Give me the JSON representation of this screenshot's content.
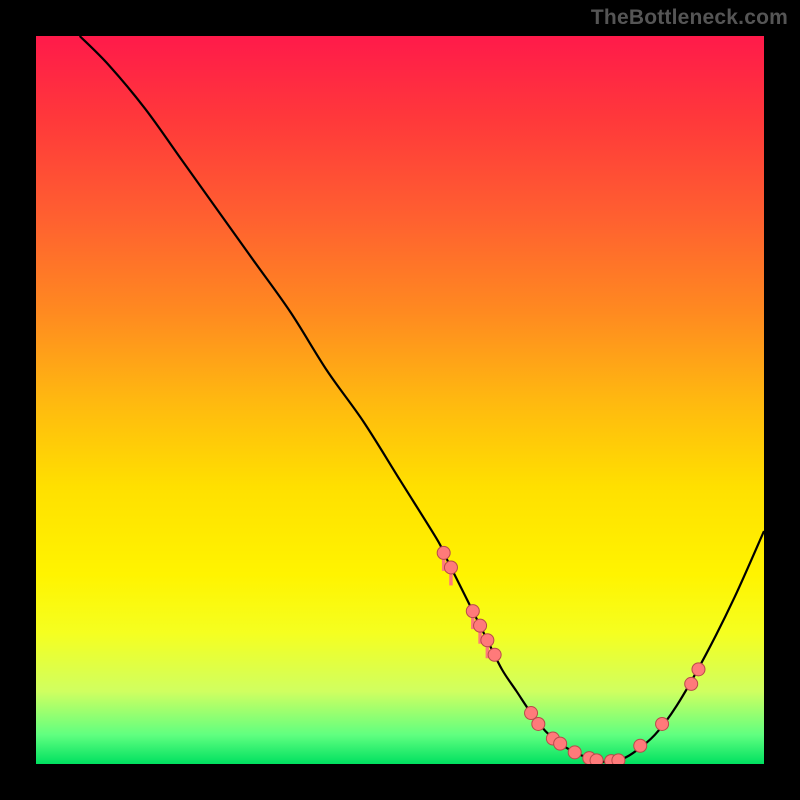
{
  "watermark": "TheBottleneck.com",
  "chart_data": {
    "type": "line",
    "title": "",
    "xlabel": "",
    "ylabel": "",
    "xlim": [
      0,
      100
    ],
    "ylim": [
      0,
      100
    ],
    "grid": false,
    "legend": false,
    "series": [
      {
        "name": "curve",
        "x": [
          6,
          10,
          15,
          20,
          25,
          30,
          35,
          40,
          45,
          50,
          55,
          56,
          58,
          60,
          62,
          64,
          66,
          68,
          70,
          72,
          74,
          76,
          78,
          80,
          82,
          85,
          88,
          92,
          96,
          100
        ],
        "values": [
          100,
          96,
          90,
          83,
          76,
          69,
          62,
          54,
          47,
          39,
          31,
          29,
          25,
          21,
          17,
          13,
          10,
          7,
          4.5,
          2.8,
          1.6,
          0.8,
          0.3,
          0.5,
          1.5,
          4,
          8,
          15,
          23,
          32
        ]
      }
    ],
    "markers": [
      {
        "x": 56,
        "y": 29,
        "drip": true
      },
      {
        "x": 57,
        "y": 27,
        "drip": true
      },
      {
        "x": 60,
        "y": 21,
        "drip": true
      },
      {
        "x": 61,
        "y": 19,
        "drip": true
      },
      {
        "x": 62,
        "y": 17,
        "drip": true
      },
      {
        "x": 63,
        "y": 15,
        "drip": false
      },
      {
        "x": 68,
        "y": 7,
        "drip": false
      },
      {
        "x": 69,
        "y": 5.5,
        "drip": false
      },
      {
        "x": 71,
        "y": 3.5,
        "drip": false
      },
      {
        "x": 72,
        "y": 2.8,
        "drip": false
      },
      {
        "x": 74,
        "y": 1.6,
        "drip": false
      },
      {
        "x": 76,
        "y": 0.8,
        "drip": false
      },
      {
        "x": 77,
        "y": 0.5,
        "drip": false
      },
      {
        "x": 79,
        "y": 0.4,
        "drip": false
      },
      {
        "x": 80,
        "y": 0.5,
        "drip": false
      },
      {
        "x": 83,
        "y": 2.5,
        "drip": false
      },
      {
        "x": 86,
        "y": 5.5,
        "drip": false
      },
      {
        "x": 90,
        "y": 11,
        "drip": false
      },
      {
        "x": 91,
        "y": 13,
        "drip": false
      }
    ],
    "colors": {
      "curve": "#000000",
      "marker_fill": "#ff7a7a",
      "marker_stroke": "#b84a4a",
      "gradient_top": "#ff1a4a",
      "gradient_bottom": "#00e060"
    }
  }
}
